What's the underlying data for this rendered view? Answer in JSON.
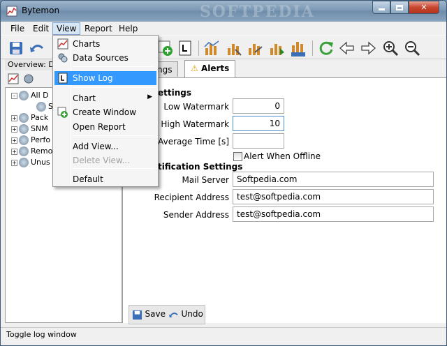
{
  "app": {
    "title": "Bytemon",
    "watermark": "SOFTPEDIA"
  },
  "menubar": [
    {
      "label": "File"
    },
    {
      "label": "Edit"
    },
    {
      "label": "View"
    },
    {
      "label": "Report"
    },
    {
      "label": "Help"
    }
  ],
  "view_menu": {
    "items": [
      {
        "label": "Charts",
        "icon": "chart-icon"
      },
      {
        "label": "Data Sources",
        "icon": "data-sources-icon"
      },
      {
        "label": "Show Log",
        "icon": "log-icon"
      },
      {
        "label": "Chart",
        "icon": ""
      },
      {
        "label": "Create Window",
        "icon": "create-window-icon"
      },
      {
        "label": "Open Report",
        "icon": ""
      },
      {
        "label": "Add View...",
        "icon": ""
      },
      {
        "label": "Delete View...",
        "icon": ""
      },
      {
        "label": "Default",
        "icon": ""
      }
    ]
  },
  "left": {
    "overview": "Overview: Da",
    "tree": [
      {
        "label": "All D",
        "expander": "-"
      },
      {
        "label": "S",
        "expander": ""
      },
      {
        "label": "Pack",
        "expander": "+"
      },
      {
        "label": "SNM",
        "expander": "+"
      },
      {
        "label": "Perfo",
        "expander": "+"
      },
      {
        "label": "Remo",
        "expander": "+"
      },
      {
        "label": "Unus",
        "expander": "+"
      }
    ]
  },
  "tabs": [
    {
      "label": "ngs"
    },
    {
      "label": "Alerts"
    }
  ],
  "alerts": {
    "section1": "ettings",
    "low_watermark_label": "Low Watermark",
    "low_watermark_value": "0",
    "high_watermark_label": "High Watermark",
    "high_watermark_value": "10",
    "moving_avg_label": "ing Average Time [s]",
    "moving_avg_value": "",
    "alert_offline_label": "Alert When Offline",
    "section2": "tification Settings",
    "mail_server_label": "Mail Server",
    "mail_server_value": "Softpedia.com",
    "recipient_label": "Recipient Address",
    "recipient_value": "test@softpedia.com",
    "sender_label": "Sender Address",
    "sender_value": "test@softpedia.com"
  },
  "bottom": {
    "save_label": "Save",
    "undo_label": "Undo"
  },
  "status": {
    "text": "Toggle log window"
  },
  "colors": {
    "highlight": "#3399ff",
    "title_bar": "#7b98b4"
  }
}
